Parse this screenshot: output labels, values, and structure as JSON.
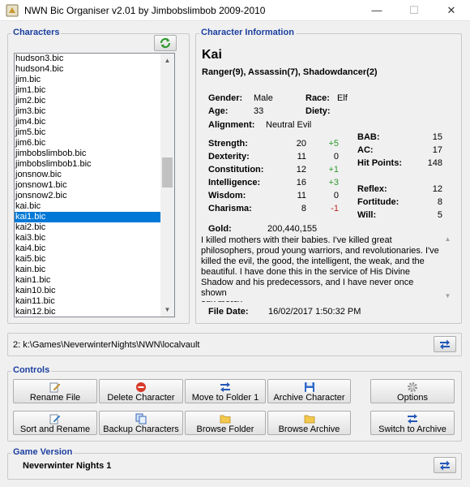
{
  "window": {
    "title": "NWN Bic Organiser v2.01 by Jimbobslimbob 2009-2010",
    "min_glyph": "—",
    "max_glyph": "☐",
    "close_glyph": "✕"
  },
  "characters": {
    "legend": "Characters",
    "items": [
      "hudson3.bic",
      "hudson4.bic",
      "jim.bic",
      "jim1.bic",
      "jim2.bic",
      "jim3.bic",
      "jim4.bic",
      "jim5.bic",
      "jim6.bic",
      "jimbobslimbob.bic",
      "jimbobslimbob1.bic",
      "jonsnow.bic",
      "jonsnow1.bic",
      "jonsnow2.bic",
      "kai.bic",
      "kai1.bic",
      "kai2.bic",
      "kai3.bic",
      "kai4.bic",
      "kai5.bic",
      "kain.bic",
      "kain1.bic",
      "kain10.bic",
      "kain11.bic",
      "kain12.bic"
    ],
    "selected": "kai1.bic"
  },
  "info": {
    "legend": "Character Information",
    "name": "Kai",
    "classes": "Ranger(9), Assassin(7), Shadowdancer(2)",
    "gender_label": "Gender:",
    "gender": "Male",
    "race_label": "Race:",
    "race": "Elf",
    "age_label": "Age:",
    "age": "33",
    "deity_label": "Diety:",
    "deity": "",
    "alignment_label": "Alignment:",
    "alignment": "Neutral Evil",
    "abilities": [
      {
        "label": "Strength:",
        "score": "20",
        "mod": "+5",
        "tone": "green"
      },
      {
        "label": "Dexterity:",
        "score": "11",
        "mod": "0",
        "tone": "black"
      },
      {
        "label": "Constitution:",
        "score": "12",
        "mod": "+1",
        "tone": "green"
      },
      {
        "label": "Intelligence:",
        "score": "16",
        "mod": "+3",
        "tone": "green"
      },
      {
        "label": "Wisdom:",
        "score": "11",
        "mod": "0",
        "tone": "black"
      },
      {
        "label": "Charisma:",
        "score": "8",
        "mod": "-1",
        "tone": "red"
      }
    ],
    "combat": [
      {
        "label": "BAB:",
        "value": "15"
      },
      {
        "label": "AC:",
        "value": "17"
      },
      {
        "label": "Hit Points:",
        "value": "148"
      }
    ],
    "saves": [
      {
        "label": "Reflex:",
        "value": "12"
      },
      {
        "label": "Fortitude:",
        "value": "8"
      },
      {
        "label": "Will:",
        "value": "5"
      }
    ],
    "gold_label": "Gold:",
    "gold": "200,440,155",
    "description_lines": [
      "I killed mothers with their babies. I've killed great",
      "philosophers, proud young warriors, and revolutionaries. I've",
      "killed the evil, the good, the intelligent, the weak, and the",
      "beautiful. I have done this in the service of His Divine",
      "Shadow and his predecessors, and I have never once shown",
      "any mercy."
    ],
    "file_date_label": "File Date:",
    "file_date": "16/02/2017 1:50:32 PM"
  },
  "path": {
    "value": "2: k:\\Games\\NeverwinterNights\\NWN\\localvault"
  },
  "controls": {
    "legend": "Controls",
    "rename_file": "Rename File",
    "delete_character": "Delete Character",
    "move_to_folder": "Move to Folder 1",
    "archive_character": "Archive Character",
    "options": "Options",
    "sort_and_rename": "Sort and Rename",
    "backup_characters": "Backup Characters",
    "browse_folder": "Browse Folder",
    "browse_archive": "Browse Archive",
    "switch_to_archive": "Switch to Archive"
  },
  "game_version": {
    "legend": "Game Version",
    "value": "Neverwinter Nights 1"
  },
  "colors": {
    "accent": "#1c3fa0",
    "selection": "#0078d7",
    "positive": "#2e9a2e",
    "negative": "#c02020"
  }
}
